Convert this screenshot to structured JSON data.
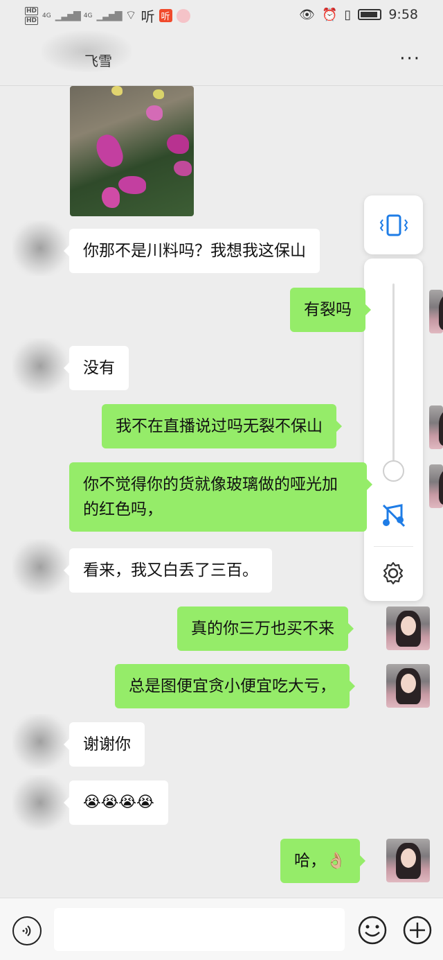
{
  "status_bar": {
    "hd1": "HD",
    "hd2": "HD",
    "net": "4G",
    "net2": "4G",
    "ting": "听",
    "ting_badge": "听",
    "time": "9:58"
  },
  "header": {
    "title": "飞雪"
  },
  "messages": [
    {
      "side": "in",
      "text": "你那不是川料吗？我想我这保山"
    },
    {
      "side": "out",
      "text": "有裂吗"
    },
    {
      "side": "in",
      "text": "没有"
    },
    {
      "side": "out",
      "text": "我不在直播说过吗无裂不保山"
    },
    {
      "side": "out",
      "text": "你不觉得你的货就像玻璃做的哑光加的红色吗，"
    },
    {
      "side": "in",
      "text": "看来，我又白丢了三百。"
    },
    {
      "side": "out",
      "text": "真的你三万也买不来"
    },
    {
      "side": "out",
      "text": "总是图便宜贪小便宜吃大亏，"
    },
    {
      "side": "in",
      "text": "谢谢你"
    },
    {
      "side": "in",
      "text": "😭😭😭😭"
    },
    {
      "side": "out",
      "text": "哈，👌🏼"
    }
  ],
  "volume_panel": {
    "level": 0.05
  },
  "input_bar": {
    "value": ""
  }
}
